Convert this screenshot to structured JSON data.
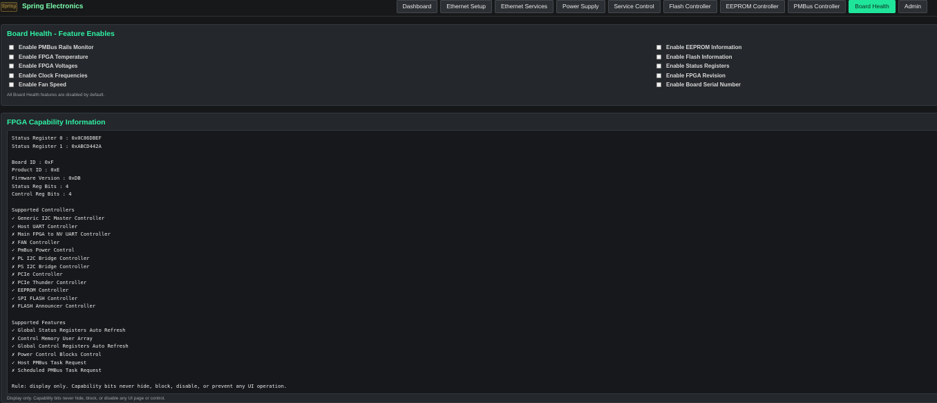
{
  "app": {
    "logo_text": "Spring",
    "brand": "Spring Electronics"
  },
  "nav": {
    "tabs": [
      {
        "label": "Dashboard",
        "active": false
      },
      {
        "label": "Ethernet Setup",
        "active": false
      },
      {
        "label": "Ethernet Services",
        "active": false
      },
      {
        "label": "Power Supply",
        "active": false
      },
      {
        "label": "Service Control",
        "active": false
      },
      {
        "label": "Flash Controller",
        "active": false
      },
      {
        "label": "EEPROM Controller",
        "active": false
      },
      {
        "label": "PMBus Controller",
        "active": false
      },
      {
        "label": "Board Health",
        "active": true
      },
      {
        "label": "Admin",
        "active": false
      }
    ]
  },
  "feature_enables": {
    "title": "Board Health - Feature Enables",
    "left": [
      {
        "label": "Enable PMBus Rails Monitor",
        "checked": false
      },
      {
        "label": "Enable FPGA Temperature",
        "checked": false
      },
      {
        "label": "Enable FPGA Voltages",
        "checked": false
      },
      {
        "label": "Enable Clock Frequencies",
        "checked": false
      },
      {
        "label": "Enable Fan Speed",
        "checked": false
      }
    ],
    "right": [
      {
        "label": "Enable EEPROM Information",
        "checked": false
      },
      {
        "label": "Enable Flash Information",
        "checked": false
      },
      {
        "label": "Enable Status Registers",
        "checked": false
      },
      {
        "label": "Enable FPGA Revision",
        "checked": false
      },
      {
        "label": "Enable Board Serial Number",
        "checked": false
      }
    ],
    "note": "All Board Health features are disabled by default."
  },
  "capability": {
    "title": "FPGA Capability Information",
    "lines": [
      "Status Register 0 : 0x0C86DBEF",
      "Status Register 1 : 0xABCD442A",
      "",
      "Board ID : 0xF",
      "Product ID : 0xE",
      "Firmware Version : 0xDB",
      "Status Reg Bits : 4",
      "Control Reg Bits : 4",
      "",
      "Supported Controllers",
      "✓ Generic I2C Master Controller",
      "✓ Host UART Controller",
      "✗ Main FPGA to NV UART Controller",
      "✗ FAN Controller",
      "✓ PmBus Power Control",
      "✗ PL I2C Bridge Controller",
      "✗ PS I2C Bridge Controller",
      "✗ PCIe Controller",
      "✗ PCIe Thunder Controller",
      "✓ EEPROM Controller",
      "✓ SPI FLASH Controller",
      "✗ FLASH Announcer Controller",
      "",
      "Supported Features",
      "✓ Global Status Registers Auto Refresh",
      "✗ Control Memory User Array",
      "✓ Global Control Registers Auto Refresh",
      "✗ Power Control Blocks Control",
      "✓ Host PMBus Task Request",
      "✗ Scheduled PMBus Task Request",
      "",
      "Rule: display only. Capability bits never hide, block, disable, or prevent any UI operation."
    ],
    "footer": "Display only. Capability bits never hide, block, or disable any UI page or control."
  }
}
